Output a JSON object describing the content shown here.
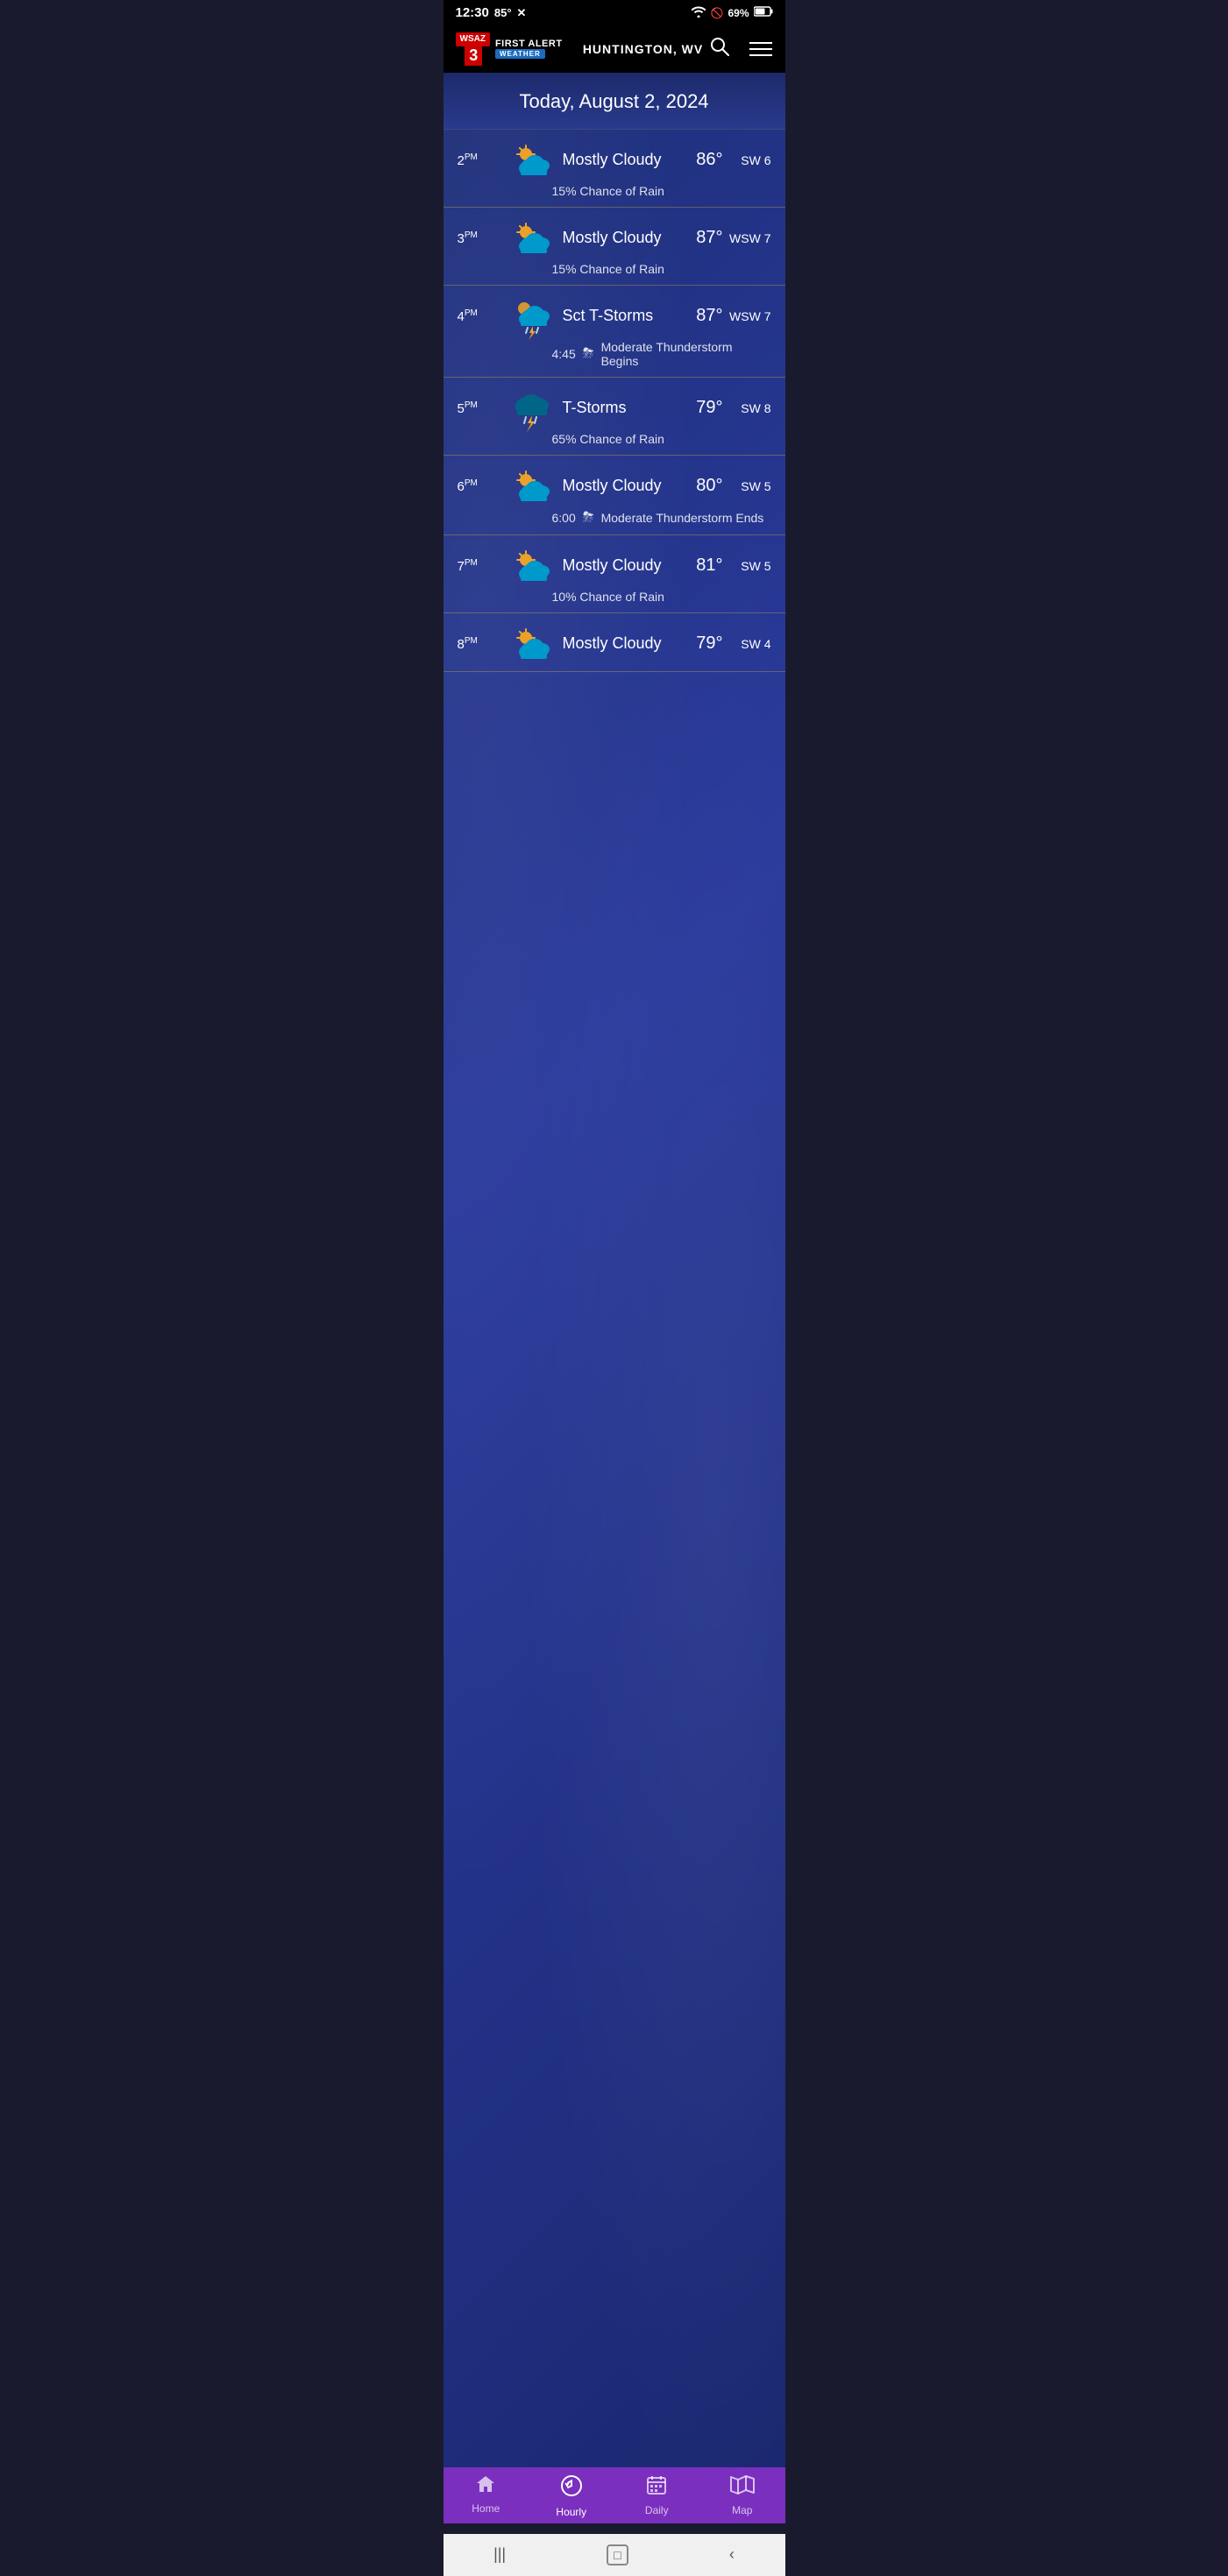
{
  "status_bar": {
    "time": "12:30",
    "temp": "85°",
    "battery": "69%",
    "wifi_icon": "wifi-icon",
    "battery_icon": "battery-icon"
  },
  "header": {
    "logo": {
      "channel": "3",
      "brand": "FIRST ALERT",
      "sub": "WEATHER"
    },
    "location": "HUNTINGTON, WV",
    "search_label": "search",
    "menu_label": "menu"
  },
  "date_header": {
    "text": "Today, August 2, 2024"
  },
  "hourly": [
    {
      "time": "2",
      "period": "PM",
      "condition": "Mostly Cloudy",
      "icon_type": "cloud-sun",
      "temp": "86°",
      "wind": "SW 6",
      "sub_text": "15% Chance of Rain",
      "sub_icon": "",
      "alert_time": ""
    },
    {
      "time": "3",
      "period": "PM",
      "condition": "Mostly Cloudy",
      "icon_type": "cloud-sun",
      "temp": "87°",
      "wind": "WSW 7",
      "sub_text": "15% Chance of Rain",
      "sub_icon": "",
      "alert_time": ""
    },
    {
      "time": "4",
      "period": "PM",
      "condition": "Sct T-Storms",
      "icon_type": "storm-cloud",
      "temp": "87°",
      "wind": "WSW 7",
      "sub_text": "Moderate Thunderstorm Begins",
      "sub_icon": "⛈",
      "alert_time": "4:45"
    },
    {
      "time": "5",
      "period": "PM",
      "condition": "T-Storms",
      "icon_type": "storm-cloud-dark",
      "temp": "79°",
      "wind": "SW 8",
      "sub_text": "65% Chance of Rain",
      "sub_icon": "",
      "alert_time": ""
    },
    {
      "time": "6",
      "period": "PM",
      "condition": "Mostly Cloudy",
      "icon_type": "cloud-sun",
      "temp": "80°",
      "wind": "SW 5",
      "sub_text": "Moderate Thunderstorm Ends",
      "sub_icon": "⛈",
      "alert_time": "6:00"
    },
    {
      "time": "7",
      "period": "PM",
      "condition": "Mostly Cloudy",
      "icon_type": "cloud-sun",
      "temp": "81°",
      "wind": "SW 5",
      "sub_text": "10% Chance of Rain",
      "sub_icon": "",
      "alert_time": ""
    },
    {
      "time": "8",
      "period": "PM",
      "condition": "Mostly Cloudy",
      "icon_type": "cloud-sun",
      "temp": "79°",
      "wind": "SW 4",
      "sub_text": "",
      "sub_icon": "",
      "alert_time": ""
    }
  ],
  "bottom_nav": {
    "items": [
      {
        "label": "Home",
        "icon": "home-icon",
        "active": false
      },
      {
        "label": "Hourly",
        "icon": "back-icon",
        "active": true
      },
      {
        "label": "Daily",
        "icon": "calendar-icon",
        "active": false
      },
      {
        "label": "Map",
        "icon": "map-icon",
        "active": false
      }
    ]
  },
  "android_nav": {
    "back": "‹",
    "home_circle": "○",
    "recents": "|||"
  }
}
